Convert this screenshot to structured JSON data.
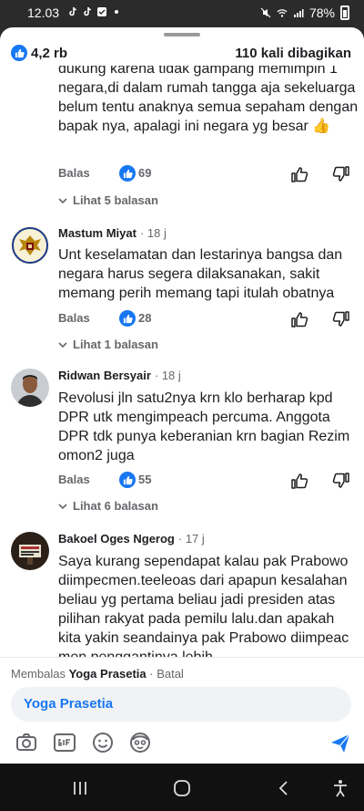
{
  "status_bar": {
    "time": "12.03",
    "battery": "78%"
  },
  "post_stats": {
    "reactions": "4,2 rb",
    "shares": "110 kali dibagikan"
  },
  "partial_comment": {
    "text": "dukung karena tidak gampang memimpin 1 negara,di dalam rumah tangga aja sekeluarga belum tentu anaknya semua sepaham dengan bapak nya, apalagi ini negara yg besar 👍",
    "reply_label": "Balas",
    "likes": "69",
    "replies_link": "Lihat 5 balasan"
  },
  "comments": [
    {
      "author": "Mastum Miyat",
      "time": "· 18 j",
      "text": "Unt keselamatan dan lestarinya bangsa dan negara harus segera dilaksanakan, sakit memang perih memang tapi itulah obatnya",
      "reply_label": "Balas",
      "likes": "28",
      "replies_link": "Lihat 1 balasan"
    },
    {
      "author": "Ridwan Bersyair",
      "time": "· 18 j",
      "text": "Revolusi jln satu2nya krn klo berharap kpd DPR utk mengimpeach percuma. Anggota DPR tdk punya keberanian krn bagian Rezim omon2 juga",
      "reply_label": "Balas",
      "likes": "55",
      "replies_link": "Lihat 6 balasan"
    },
    {
      "author": "Bakoel Oges Ngerog",
      "time": "· 17 j",
      "text": "Saya kurang sependapat kalau pak Prabowo diimpecmen.teeleoas dari apapun kesalahan beliau yg pertama beliau jadi presiden atas pilihan rakyat pada pemilu lalu.dan apakah kita yakin seandainya pak Prabowo diimpeac men penggantinya lebih"
    }
  ],
  "composer": {
    "replying_prefix": "Membalas",
    "replying_to": "Yoga Prasetia",
    "cancel": "· Batal",
    "mention": "Yoga Prasetia"
  },
  "colors": {
    "accent": "#1877f2",
    "muted": "#65676b",
    "text": "#1c1e21"
  }
}
